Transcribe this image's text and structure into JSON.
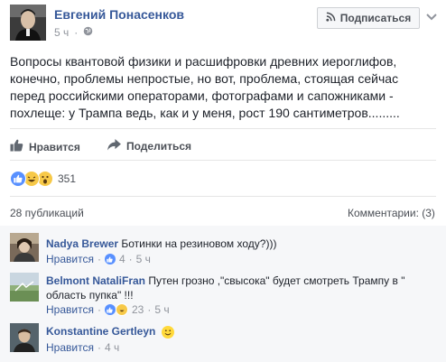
{
  "post": {
    "author": "Евгений Понасенков",
    "time": "5 ч",
    "subscribe_label": "Подписаться",
    "text": "Вопросы квантовой физики и расшифровки древних иероглифов, конечно, проблемы непростые, но вот, проблема, стоящая сейчас перед российскими операторами, фотографами и сапожниками - похлеще: у Трампа ведь, как и у меня, рост 190 сантиметров.........",
    "actions": {
      "like": "Нравится",
      "share": "Поделиться"
    },
    "reactions": {
      "types": [
        "like",
        "haha",
        "wow"
      ],
      "count": "351"
    },
    "shares": "28 публикаций",
    "comments_label": "Комментарии: (3)"
  },
  "comments": [
    {
      "name": "Nadya Brewer",
      "text": "Ботинки на резиновом ходу?)))",
      "like": "Нравится",
      "reactions": "4",
      "time": "5 ч"
    },
    {
      "name": "Belmont NataliFran",
      "text": "Путен грозно ,\"свысока\" будет смотреть Трампу в \" область пупка\" !!!",
      "like": "Нравится",
      "reactions": "23",
      "time": "5 ч"
    },
    {
      "name": "Konstantine Gertleyn",
      "text": "",
      "like": "Нравится",
      "time": "4 ч"
    }
  ],
  "colors": {
    "link": "#365899",
    "muted": "#90949c",
    "like_blue": "#5890ff",
    "emoji_yellow": "#f7c948"
  }
}
